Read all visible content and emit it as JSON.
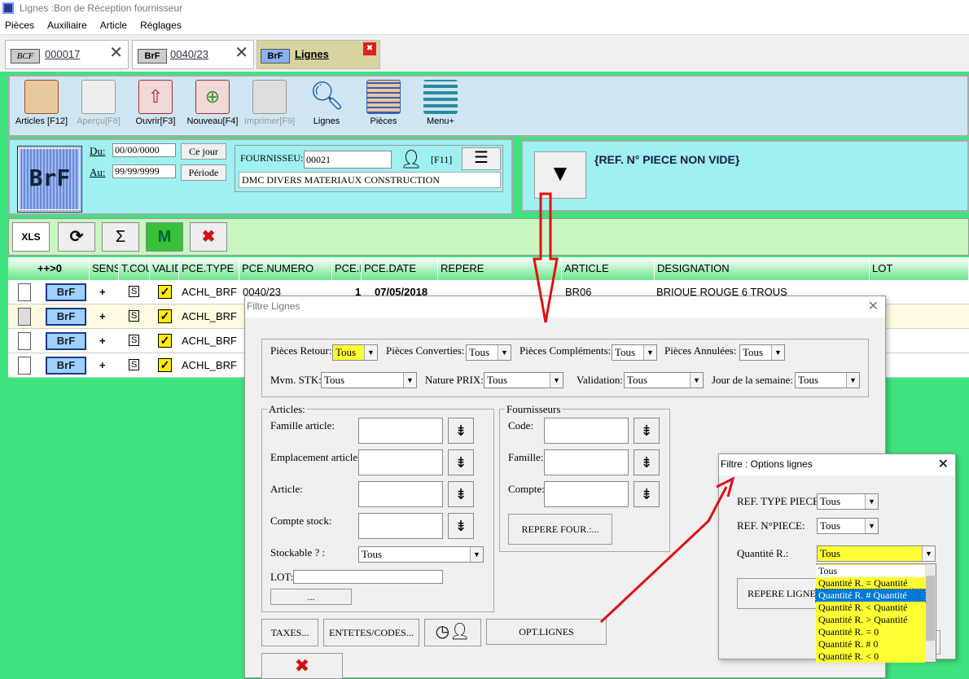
{
  "window": {
    "title": "Lignes :Bon de Réception fournisseur"
  },
  "menu": [
    "Pièces",
    "Auxiliaire",
    "Article",
    "Réglages"
  ],
  "tabs": [
    {
      "badge": "BCF",
      "label": "000017",
      "close": "✕"
    },
    {
      "badge": "BrF",
      "label": "0040/23",
      "close": "✕"
    },
    {
      "badge": "BrF",
      "label": "Lignes",
      "close": "✖"
    }
  ],
  "toolbar": [
    {
      "label": "Articles [F12]",
      "icon": "grid-icon"
    },
    {
      "label": "Aperçu[F8]",
      "icon": "preview-icon"
    },
    {
      "label": "Ouvrir[F3]",
      "icon": "open-icon"
    },
    {
      "label": "Nouveau[F4]",
      "icon": "new-icon"
    },
    {
      "label": "Imprimer[F9]",
      "icon": "print-icon"
    },
    {
      "label": "Lignes",
      "icon": "search-icon"
    },
    {
      "label": "Pièces",
      "icon": "pieces-icon"
    },
    {
      "label": "Menu+",
      "icon": "menu-icon"
    }
  ],
  "header": {
    "badge": "BrF",
    "du_label": "Du:",
    "du_value": "00/00/0000",
    "au_label": "Au:",
    "au_value": "99/99/9999",
    "ce_jour": "Ce jour",
    "periode": "Période",
    "fournisseur_label": "FOURNISSEU:",
    "fournisseur_value": "00021",
    "f11": "[F11]",
    "fournisseur_name": "DMC DIVERS MATERIAUX CONSTRUCTION"
  },
  "filter_text": "{REF. N° PIECE NON VIDE}",
  "actions": [
    "XLS",
    "⟳",
    "Σ",
    "M",
    "✖"
  ],
  "grid": {
    "columns": [
      "++>0",
      "SENS",
      "T.COU",
      "VALID",
      "PCE.TYPE",
      "PCE.NUMERO",
      "PCE.L",
      "PCE.DATE",
      "REPERE",
      "ARTICLE",
      "DESIGNATION",
      "LOT"
    ],
    "rows": [
      {
        "badge": "BrF",
        "sens": "+",
        "tc": "S",
        "type": "ACHL_BRF",
        "numero": "0040/23",
        "pcel": "1",
        "date": "07/05/2018",
        "article": "BR06",
        "designation": "BRIQUE ROUGE 6 TROUS"
      },
      {
        "badge": "BrF",
        "sens": "+",
        "tc": "S",
        "type": "ACHL_BRF",
        "numero": "",
        "pcel": "",
        "date": "",
        "article": "",
        "designation": ""
      },
      {
        "badge": "BrF",
        "sens": "+",
        "tc": "S",
        "type": "ACHL_BRF",
        "numero": "",
        "pcel": "",
        "date": "",
        "article": "",
        "designation": ""
      },
      {
        "badge": "BrF",
        "sens": "+",
        "tc": "S",
        "type": "ACHL_BRF",
        "numero": "",
        "pcel": "",
        "date": "",
        "article": "",
        "designation": ""
      }
    ]
  },
  "dialog": {
    "title": "Filtre Lignes",
    "pieces_retour": "Pièces Retour:",
    "pieces_retour_val": "Tous",
    "pieces_converties": "Pièces Converties:",
    "pieces_converties_val": "Tous",
    "pieces_complements": "Pièces Compléments:",
    "pieces_complements_val": "Tous",
    "pieces_annulees": "Pièces Annulées:",
    "pieces_annulees_val": "Tous",
    "mvm_stk": "Mvm. STK:",
    "mvm_stk_val": "Tous",
    "nature_prix": "Nature PRIX:",
    "nature_prix_val": "Tous",
    "validation": "Validation:",
    "validation_val": "Tous",
    "jour_semaine": "Jour de la semaine:",
    "jour_semaine_val": "Tous",
    "articles_group": "Articles:",
    "famille_article": "Famille article:",
    "emplacement_article": "Emplacement article:",
    "article": "Article:",
    "compte_stock": "Compte stock:",
    "stockable": "Stockable ? :",
    "stockable_val": "Tous",
    "lot": "LOT:",
    "dots": "...",
    "fournisseurs_group": "Fournisseurs",
    "code": "Code:",
    "famille": "Famille:",
    "compte": "Compte:",
    "repere_four": "REPERE FOUR.:...",
    "taxes": "TAXES...",
    "entetes": "ENTETES/CODES...",
    "opt_lignes": "OPT.LIGNES"
  },
  "dialog2": {
    "title": "Filtre : Options lignes",
    "ref_type": "REF. TYPE PIECE:",
    "ref_type_val": "Tous",
    "ref_num": "REF. N°PIECE:",
    "ref_num_val": "Tous",
    "quantite": "Quantité R.:",
    "quantite_val": "Tous",
    "repere": "REPERE LIGNE",
    "options": [
      "Tous",
      "Quantité R. = Quantité",
      "Quantité R. # Quantité",
      "Quantité R. < Quantité",
      "Quantité R. > Quantité",
      "Quantité R. = 0",
      "Quantité R. # 0",
      "Quantité R. < 0"
    ],
    "selected_index": 2
  },
  "colors": {
    "grid_bg": "#3ee27e",
    "header_bg": "#9ff0f0",
    "highlight": "#ffff33",
    "selected": "#0078d7",
    "arrow": "#e01010"
  }
}
